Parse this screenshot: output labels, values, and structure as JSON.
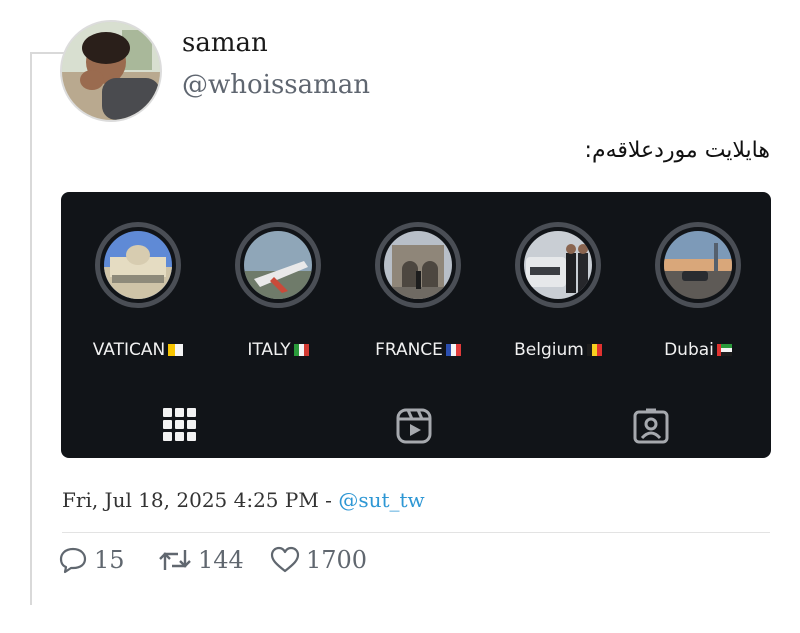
{
  "tweet": {
    "author_name": "saman",
    "author_handle": "@whoissaman",
    "text": "هایلایت موردعلاقه‌م:",
    "timestamp": "Fri, Jul 18, 2025 4:25 PM",
    "separator": " - ",
    "via_handle": "@sut_tw"
  },
  "highlights": [
    {
      "label": "VATICAN",
      "flag": "vatican-flag"
    },
    {
      "label": "ITALY",
      "flag": "italy-flag"
    },
    {
      "label": "FRANCE",
      "flag": "france-flag"
    },
    {
      "label": "Belgium",
      "flag": "belgium-flag"
    },
    {
      "label": "Dubai",
      "flag": "uae-flag"
    }
  ],
  "profile_tabs": [
    "grid-icon",
    "reels-icon",
    "tagged-icon"
  ],
  "stats": {
    "replies": "15",
    "retweets": "144",
    "likes": "1700"
  },
  "colors": {
    "card_bg": "#111418",
    "link": "#2e97d4",
    "muted": "#60676f"
  }
}
